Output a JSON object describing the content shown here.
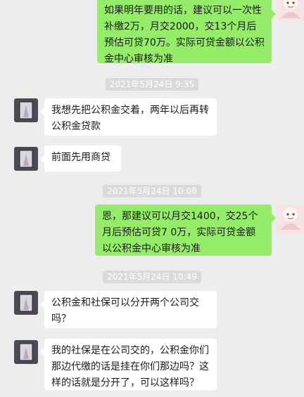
{
  "messages": [
    {
      "id": "m1",
      "from": "me",
      "text": "如果明年要用的话，建议可以一次性补缴2万，月交2000，交13个月后预估可贷70万。实际可贷金额以公积金中心审核为准"
    },
    {
      "id": "t1",
      "type": "timestamp",
      "text": "2021年5月24日 9:35"
    },
    {
      "id": "m2",
      "from": "contact",
      "text": "我想先把公积金交着，两年以后再转公积金贷款"
    },
    {
      "id": "m3",
      "from": "contact",
      "text": "前面先用商贷"
    },
    {
      "id": "t2",
      "type": "timestamp",
      "text": "2021年5月24日 10:08"
    },
    {
      "id": "m4",
      "from": "me",
      "text": "恩，那建议可以月交1400，交25个月后预估可贷7 0万，实际可贷金额以公积金中心审核为准"
    },
    {
      "id": "t3",
      "type": "timestamp",
      "text": "2021年5月24日 10:49"
    },
    {
      "id": "m5",
      "from": "contact",
      "text": "公积金和社保可以分开两个公司交吗？"
    },
    {
      "id": "m6",
      "from": "contact",
      "text": "我的社保是在公司交的，公积金你们那边代缴的话是挂在你们那边吗？这样的话就是分开了，可以这样吗？"
    }
  ],
  "colors": {
    "background": "#ededed",
    "outgoing_bubble": "#95ec69",
    "incoming_bubble": "#ffffff",
    "timestamp_bg": "#dadada"
  }
}
